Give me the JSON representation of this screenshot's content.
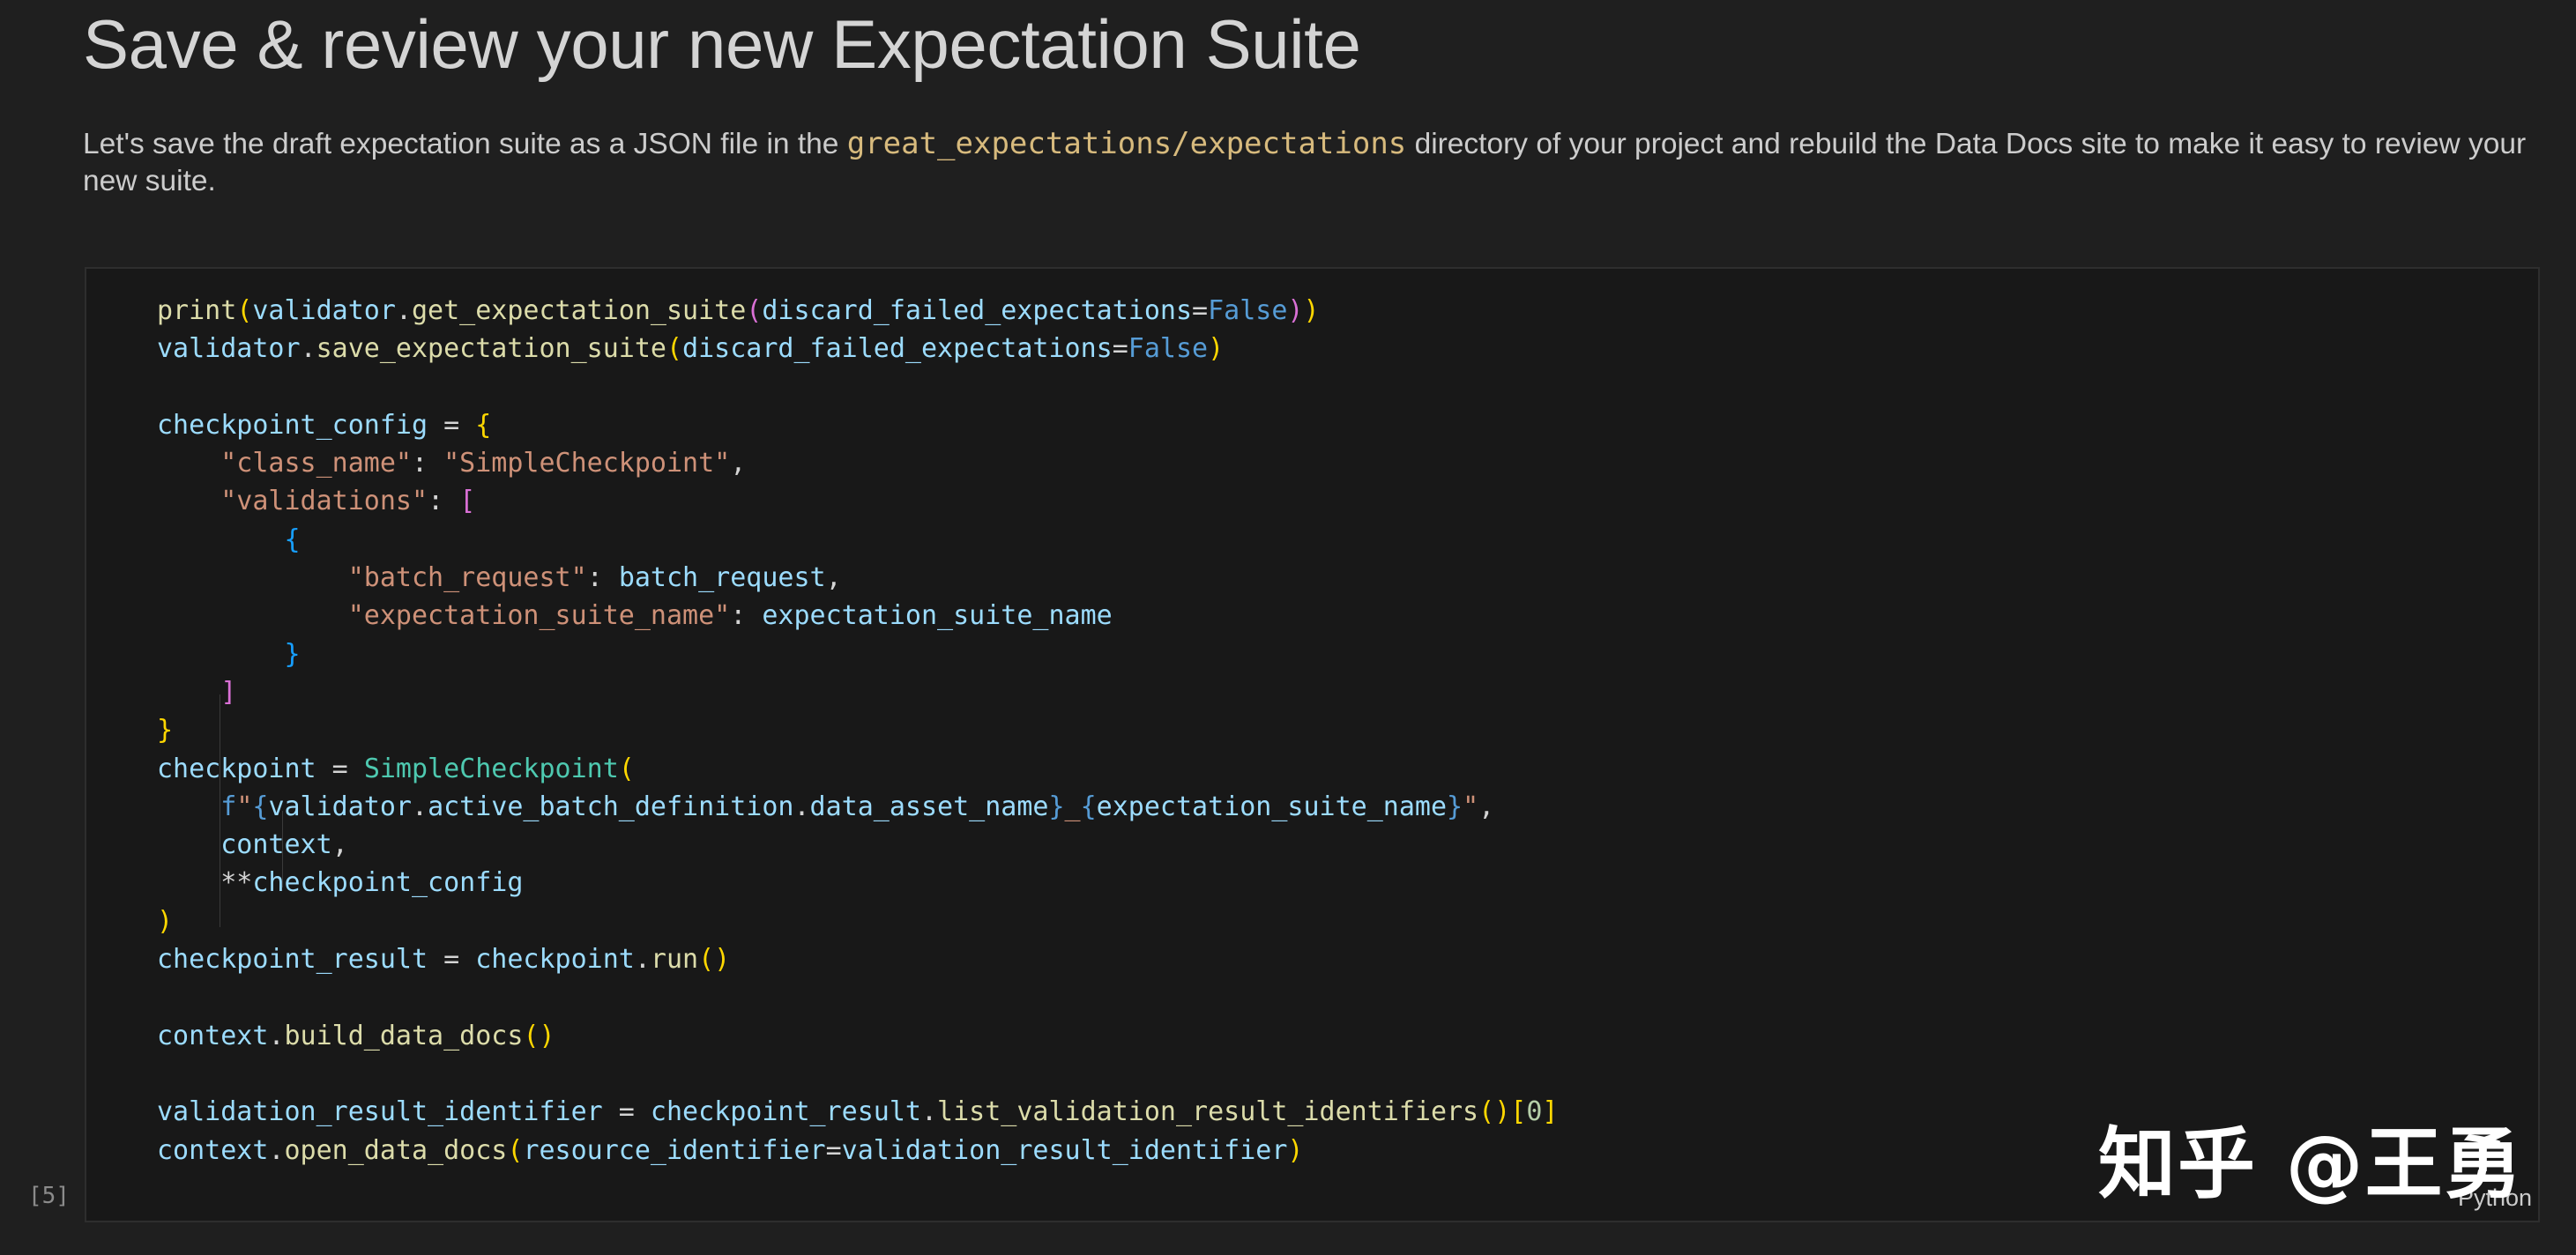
{
  "markdown": {
    "title": "Save & review your new Expectation Suite",
    "para_before": "Let's save the draft expectation suite as a JSON file in the ",
    "para_code": "great_expectations/expectations",
    "para_after": " directory of your project and rebuild the Data Docs site to make it easy to review your new suite."
  },
  "code_cell": {
    "execution_count": "[5]",
    "language": "Python",
    "lines": [
      "print(validator.get_expectation_suite(discard_failed_expectations=False))",
      "validator.save_expectation_suite(discard_failed_expectations=False)",
      "",
      "checkpoint_config = {",
      "    \"class_name\": \"SimpleCheckpoint\",",
      "    \"validations\": [",
      "        {",
      "            \"batch_request\": batch_request,",
      "            \"expectation_suite_name\": expectation_suite_name",
      "        }",
      "    ]",
      "}",
      "checkpoint = SimpleCheckpoint(",
      "    f\"{validator.active_batch_definition.data_asset_name}_{expectation_suite_name}\",",
      "    context,",
      "    **checkpoint_config",
      ")",
      "checkpoint_result = checkpoint.run()",
      "",
      "context.build_data_docs()",
      "",
      "validation_result_identifier = checkpoint_result.list_validation_result_identifiers()[0]",
      "context.open_data_docs(resource_identifier=validation_result_identifier)"
    ]
  },
  "watermark": "知乎 @王勇",
  "colors": {
    "background": "#1f1f1f",
    "cell_background": "#181818",
    "function": "#dcdcaa",
    "variable": "#9cdcfe",
    "keyword": "#569cd6",
    "string": "#ce9178",
    "class": "#4ec9b0",
    "inline_code": "#d7ba7d"
  }
}
